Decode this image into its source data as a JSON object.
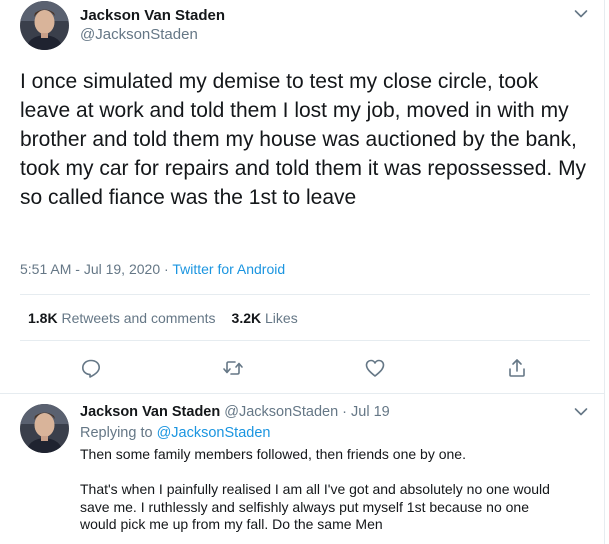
{
  "main_tweet": {
    "author_name": "Jackson Van Staden",
    "author_handle": "@JacksonStaden",
    "text": "I once simulated my demise to test my close circle, took leave at work and told them I lost my job, moved in with my brother and told them my house was auctioned by the bank, took my car for repairs and told them it was repossessed. My so called fiance was the 1st to leave",
    "time": "5:51 AM",
    "date": "Jul 19, 2020",
    "separator": "·",
    "source": "Twitter for Android",
    "retweets_count": "1.8K",
    "retweets_label": "Retweets and comments",
    "likes_count": "3.2K",
    "likes_label": "Likes"
  },
  "actions": [
    {
      "icon": "reply-icon"
    },
    {
      "icon": "retweet-icon"
    },
    {
      "icon": "like-heart-icon"
    },
    {
      "icon": "share-icon"
    }
  ],
  "reply_tweet": {
    "author_name": "Jackson Van Staden",
    "author_handle": "@JacksonStaden",
    "separator": "·",
    "date": "Jul 19",
    "replying_to_label": "Replying to",
    "replying_to_handle": "@JacksonStaden",
    "lines": [
      "Then some family members followed, then friends one by one.",
      "",
      "That's when I painfully realised I am all I've got and absolutely no one would",
      "save me. I ruthlessly and selfishly always put myself 1st because no one",
      "would pick me up from my fall. Do the same Men"
    ]
  },
  "colors": {
    "link": "#1b95e0",
    "secondary_text": "#657786",
    "primary_text": "#14171a",
    "divider": "#e6ecf0"
  }
}
